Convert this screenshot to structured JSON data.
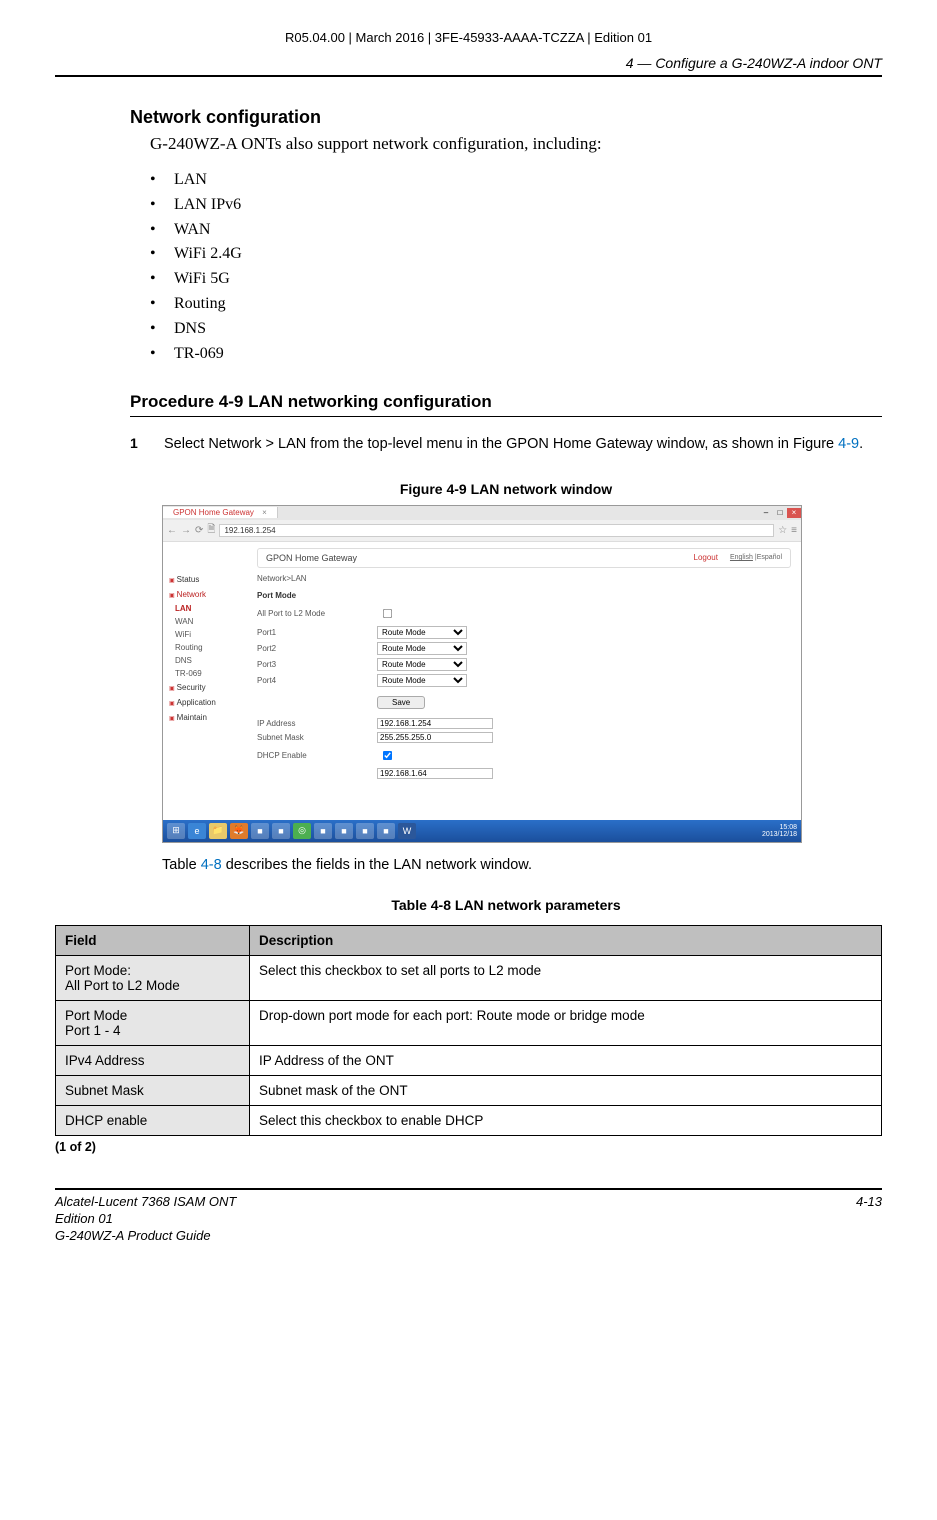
{
  "doc_id": "R05.04.00 | March 2016 | 3FE-45933-AAAA-TCZZA | Edition 01",
  "chapter_title": "4 —  Configure a G-240WZ-A indoor ONT",
  "section_heading": "Network configuration",
  "intro": "G-240WZ-A ONTs also support network configuration, including:",
  "bullets": [
    "LAN",
    "LAN IPv6",
    "WAN",
    "WiFi 2.4G",
    "WiFi 5G",
    "Routing",
    "DNS",
    "TR-069"
  ],
  "procedure_title": "Procedure 4-9  LAN networking configuration",
  "step": {
    "num": "1",
    "text_before": "Select Network > LAN from the top-level menu in the GPON Home Gateway window, as shown in Figure ",
    "fig_ref": "4-9",
    "text_after": "."
  },
  "figure_caption": "Figure 4-9  LAN network window",
  "screenshot": {
    "tab_title": "GPON Home Gateway",
    "url": "192.168.1.254",
    "app_title": "GPON Home Gateway",
    "logout": "Logout",
    "lang_en": "English",
    "lang_es": "Español",
    "breadcrumb": "Network>LAN",
    "sidebar": {
      "status": "Status",
      "network": "Network",
      "sub": [
        "LAN",
        "WAN",
        "WiFi",
        "Routing",
        "DNS",
        "TR-069"
      ],
      "security": "Security",
      "application": "Application",
      "maintain": "Maintain"
    },
    "form": {
      "port_mode_title": "Port Mode",
      "all_l2": "All Port to L2 Mode",
      "port1": "Port1",
      "port2": "Port2",
      "port3": "Port3",
      "port4": "Port4",
      "route_mode": "Route Mode",
      "save": "Save",
      "ip_label": "IP Address",
      "ip_value": "192.168.1.254",
      "mask_label": "Subnet Mask",
      "mask_value": "255.255.255.0",
      "dhcp_label": "DHCP Enable",
      "last_value": "192.168.1.64"
    },
    "taskbar_time": "15:08",
    "taskbar_date": "2013/12/18"
  },
  "after_figure_text_before": "Table ",
  "after_figure_ref": "4-8",
  "after_figure_text_after": " describes the fields in the LAN network window.",
  "table_caption": "Table 4-8 LAN network parameters",
  "table": {
    "headers": [
      "Field",
      "Description"
    ],
    "rows": [
      [
        "Port Mode:\nAll Port to L2 Mode",
        "Select this checkbox to set all ports to L2 mode"
      ],
      [
        "Port Mode\nPort 1 - 4",
        "Drop-down port mode for each port: Route mode or bridge mode"
      ],
      [
        "IPv4 Address",
        "IP Address of the ONT"
      ],
      [
        "Subnet Mask",
        "Subnet mask of the ONT"
      ],
      [
        "DHCP enable",
        "Select this checkbox to enable DHCP"
      ]
    ]
  },
  "page_note": "(1 of 2)",
  "footer": {
    "left1": "Alcatel-Lucent 7368 ISAM ONT",
    "left2": "Edition 01",
    "left3": "G-240WZ-A Product Guide",
    "right": "4-13"
  }
}
